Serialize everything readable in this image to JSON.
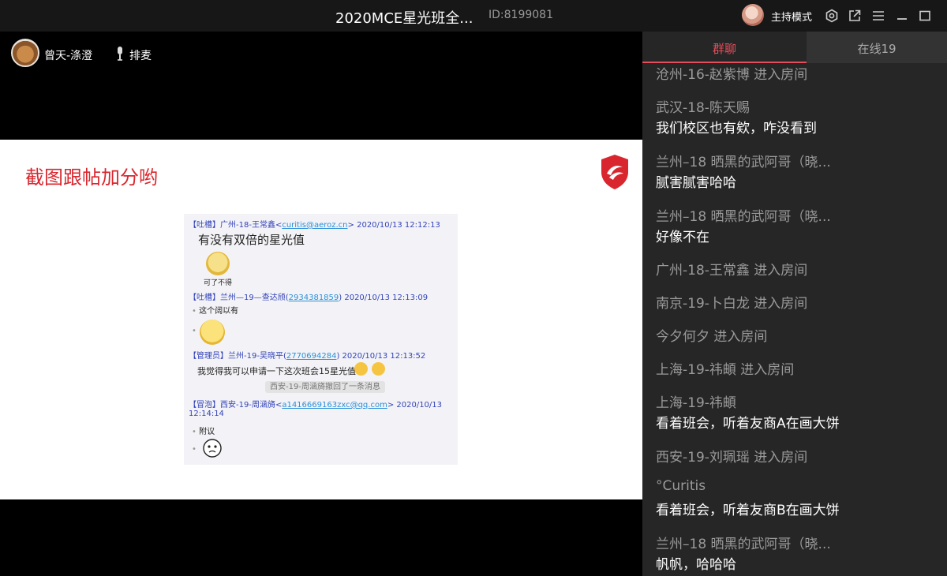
{
  "titlebar": {
    "title": "2020MCE星光班全...",
    "room_id": "ID:8199081",
    "host_mode": "主持模式"
  },
  "video": {
    "presenter_name": "曾天-涤澄",
    "mic_label": "排麦",
    "slide": {
      "title": "截图跟帖加分哟",
      "chat_screenshot": {
        "m1_tag": "【吐槽】",
        "m1_name": "广州-18-王常鑫<",
        "m1_mail": "curitis@aeroz.cn",
        "m1_date": "> 2020/10/13 12:12:13",
        "m1_text": "有没有双倍的星光值",
        "m1_sticker_caption": "可了不得",
        "m2_tag": "【吐槽】",
        "m2_name": "兰州—19—查达颀(",
        "m2_qq": "2934381859",
        "m2_date": ") 2020/10/13 12:13:09",
        "m2_text": "这个阔以有",
        "m3_tag": "【管理员】",
        "m3_name": "兰州-19-吴晓平(",
        "m3_qq": "2770694284",
        "m3_date": ") 2020/10/13 12:13:52",
        "m3_text": "我觉得我可以申请一下这次班会15星光值",
        "recall": "西安-19-周涵旖撤回了一条消息",
        "m4_tag": "【冒泡】",
        "m4_name": "西安-19-周涵旖<",
        "m4_mail": "a1416669163zxc@qq.com",
        "m4_date": "> 2020/10/13",
        "m4_time": "12:14:14",
        "m4_text": "附议",
        "dot": "•"
      }
    }
  },
  "sidebar": {
    "tabs": [
      {
        "label": "群聊",
        "active": true
      },
      {
        "label": "在线19",
        "active": false
      }
    ],
    "messages": [
      {
        "type": "system",
        "text": "沧州-16-赵紫博 进入房间"
      },
      {
        "type": "chat",
        "name": "武汉-18-陈天赐",
        "text": "我们校区也有欸，咋没看到"
      },
      {
        "type": "chat",
        "name": "兰州–18 晒黑的武阿哥（晓...",
        "text": "腻害腻害哈哈"
      },
      {
        "type": "chat",
        "name": "兰州–18 晒黑的武阿哥（晓...",
        "text": "好像不在"
      },
      {
        "type": "system",
        "text": "广州-18-王常鑫 进入房间"
      },
      {
        "type": "system",
        "text": "南京-19-卜白龙 进入房间"
      },
      {
        "type": "system",
        "text": "今夕何夕 进入房间"
      },
      {
        "type": "system",
        "text": "上海-19-祎頔 进入房间"
      },
      {
        "type": "chat",
        "name": "上海-19-祎頔",
        "text": "看着班会，听着友商A在画大饼"
      },
      {
        "type": "system",
        "text": "西安-19-刘珮瑶 进入房间"
      },
      {
        "type": "chat",
        "name": "°Curitis",
        "text": "看着班会，听着友商B在画大饼"
      },
      {
        "type": "chat",
        "name": "兰州–18 晒黑的武阿哥（晓...",
        "text": "帆帆，哈哈哈"
      }
    ]
  },
  "colors": {
    "accent": "#e44d5a",
    "slide_title": "#d9262e",
    "sidebar_bg": "#262626"
  }
}
